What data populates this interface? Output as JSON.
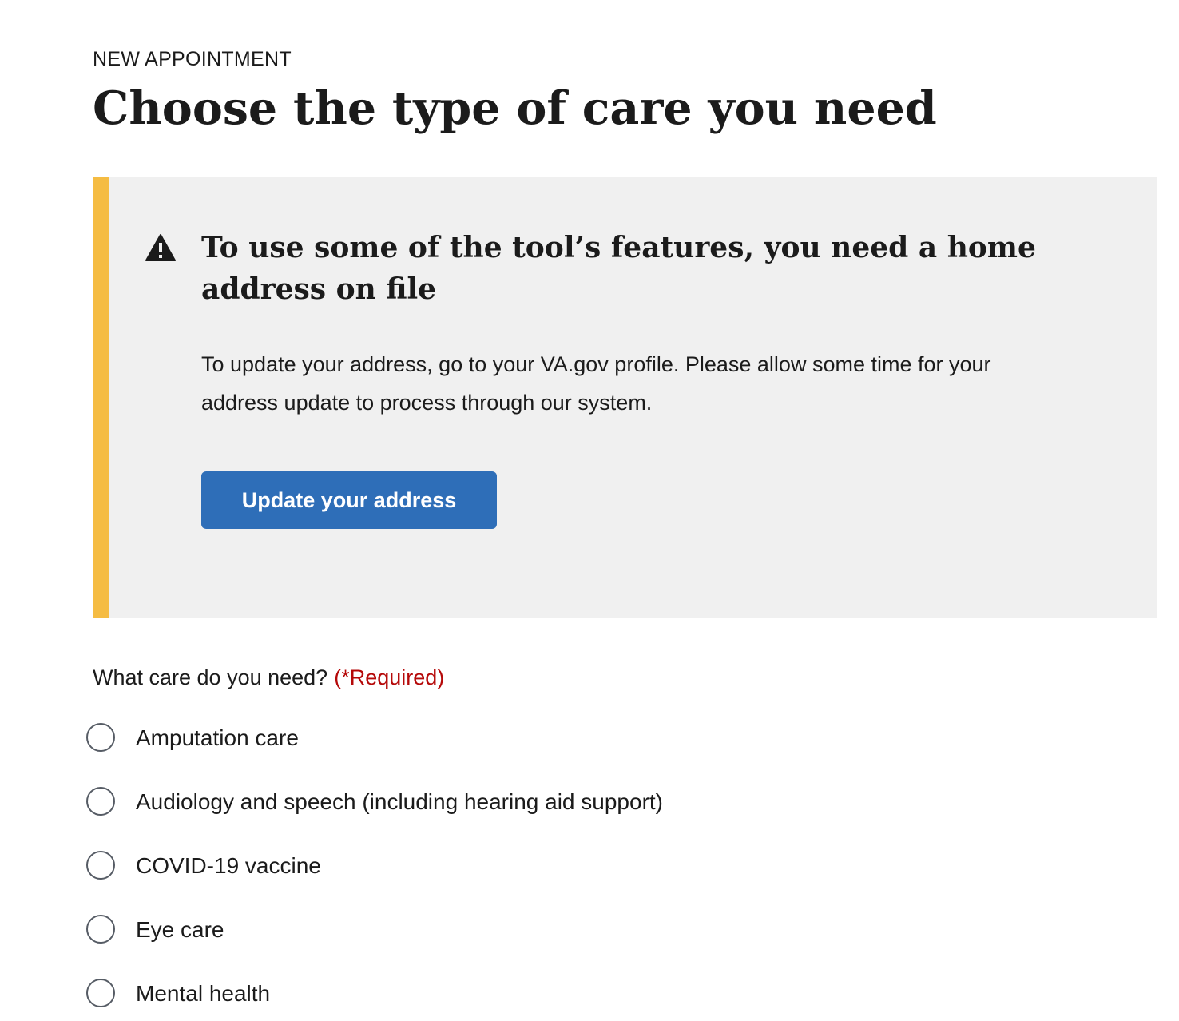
{
  "header": {
    "eyebrow": "NEW APPOINTMENT",
    "title": "Choose the type of care you need"
  },
  "alert": {
    "icon": "warning-icon",
    "accent_color": "#f5bc43",
    "background_color": "#f0f0f0",
    "heading": "To use some of the tool’s features, you need a home address on file",
    "body": "To update your address, go to your VA.gov profile. Please allow some time for your address update to process through our system.",
    "button_label": "Update your address",
    "button_color": "#2e6eb8"
  },
  "form": {
    "question": "What care do you need?",
    "required_label": "(*Required)",
    "required_color": "#b50909",
    "options": [
      {
        "label": "Amputation care",
        "selected": false
      },
      {
        "label": "Audiology and speech (including hearing aid support)",
        "selected": false
      },
      {
        "label": "COVID-19 vaccine",
        "selected": false
      },
      {
        "label": "Eye care",
        "selected": false
      },
      {
        "label": "Mental health",
        "selected": false
      }
    ]
  }
}
